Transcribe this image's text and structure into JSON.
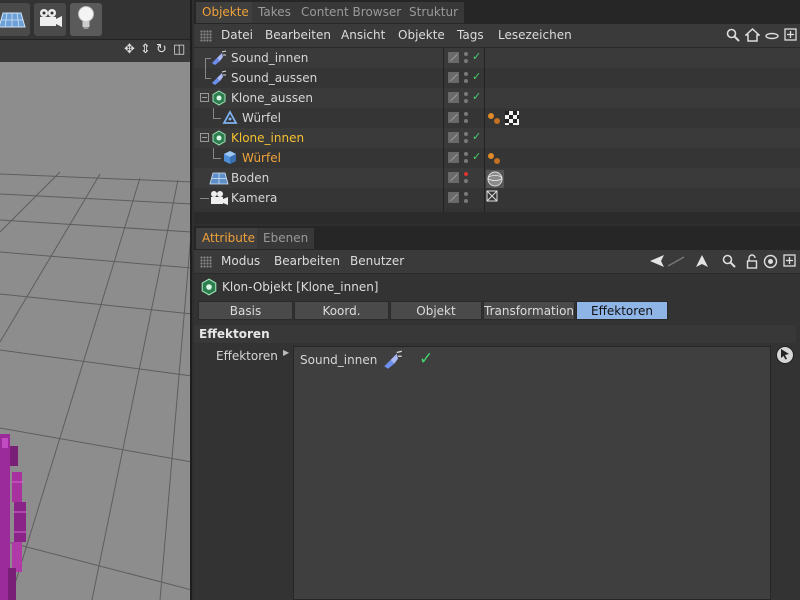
{
  "viewport": {
    "tools": [
      "grid-floor-icon",
      "camera-icon",
      "light-bulb-icon"
    ],
    "nav_icons": [
      "move-icon",
      "zoom-icon",
      "rotate-icon",
      "maximize-icon"
    ]
  },
  "objects_manager": {
    "tabs": [
      {
        "label": "Objekte",
        "active": true
      },
      {
        "label": "Takes",
        "active": false
      },
      {
        "label": "Content Browser",
        "active": false
      },
      {
        "label": "Struktur",
        "active": false
      }
    ],
    "menu": [
      "Datei",
      "Bearbeiten",
      "Ansicht",
      "Objekte",
      "Tags",
      "Lesezeichen"
    ],
    "toolbar_icons": [
      "search-icon",
      "home-icon",
      "chevron-icon",
      "new-window-icon"
    ],
    "tree": [
      {
        "name": "Sound_innen",
        "icon": "sound-effector-icon",
        "depth": 0,
        "expander": false,
        "state": "normal",
        "check": true,
        "dots": "normal",
        "tags": []
      },
      {
        "name": "Sound_aussen",
        "icon": "sound-effector-icon",
        "depth": 0,
        "expander": false,
        "state": "normal",
        "check": true,
        "dots": "normal",
        "tags": []
      },
      {
        "name": "Klone_aussen",
        "icon": "cloner-icon",
        "depth": 0,
        "expander": true,
        "state": "normal",
        "check": true,
        "dots": "normal",
        "tags": []
      },
      {
        "name": "Würfel",
        "icon": "cube-icon",
        "depth": 1,
        "expander": false,
        "state": "normal",
        "check": false,
        "dots": "normal",
        "tags": [
          "material-tag-icon",
          "checker-tag-icon"
        ]
      },
      {
        "name": "Klone_innen",
        "icon": "cloner-icon",
        "depth": 0,
        "expander": true,
        "state": "selected",
        "check": true,
        "dots": "normal",
        "tags": []
      },
      {
        "name": "Würfel",
        "icon": "cube-icon",
        "depth": 1,
        "expander": false,
        "state": "child-selected",
        "check": true,
        "dots": "normal",
        "tags": [
          "material-tag-icon"
        ]
      },
      {
        "name": "Boden",
        "icon": "floor-icon",
        "depth": 0,
        "expander": false,
        "state": "normal",
        "check": false,
        "dots": "red",
        "tags": [
          "sphere-material-tag-icon"
        ]
      },
      {
        "name": "Kamera",
        "icon": "camera-object-icon",
        "depth": 0,
        "expander": false,
        "state": "normal",
        "check": false,
        "dots": "normal",
        "tags": [
          "target-tag-icon"
        ]
      }
    ]
  },
  "attribute_manager": {
    "tabs": [
      {
        "label": "Attribute",
        "active": true
      },
      {
        "label": "Ebenen",
        "active": false
      }
    ],
    "menu": [
      "Modus",
      "Bearbeiten",
      "Benutzer"
    ],
    "toolbar_icons": [
      "back-arrow-icon",
      "forward-arrow-icon",
      "up-arrow-icon",
      "search-icon",
      "lock-icon",
      "target-icon",
      "new-window-icon"
    ],
    "object_title": "Klon-Objekt [Klone_innen]",
    "property_tabs": [
      {
        "label": "Basis",
        "active": false
      },
      {
        "label": "Koord.",
        "active": false
      },
      {
        "label": "Objekt",
        "active": false
      },
      {
        "label": "Transformation",
        "active": false
      },
      {
        "label": "Effektoren",
        "active": true
      }
    ],
    "section_title": "Effektoren",
    "field_label": "Effektoren",
    "effectors": [
      {
        "name": "Sound_innen",
        "enabled": true
      }
    ]
  },
  "colors": {
    "accent_orange": "#f0a23a",
    "selected_yellow": "#f5c030",
    "active_tab_blue": "#8fb4e6",
    "check_green": "#44d36b"
  }
}
